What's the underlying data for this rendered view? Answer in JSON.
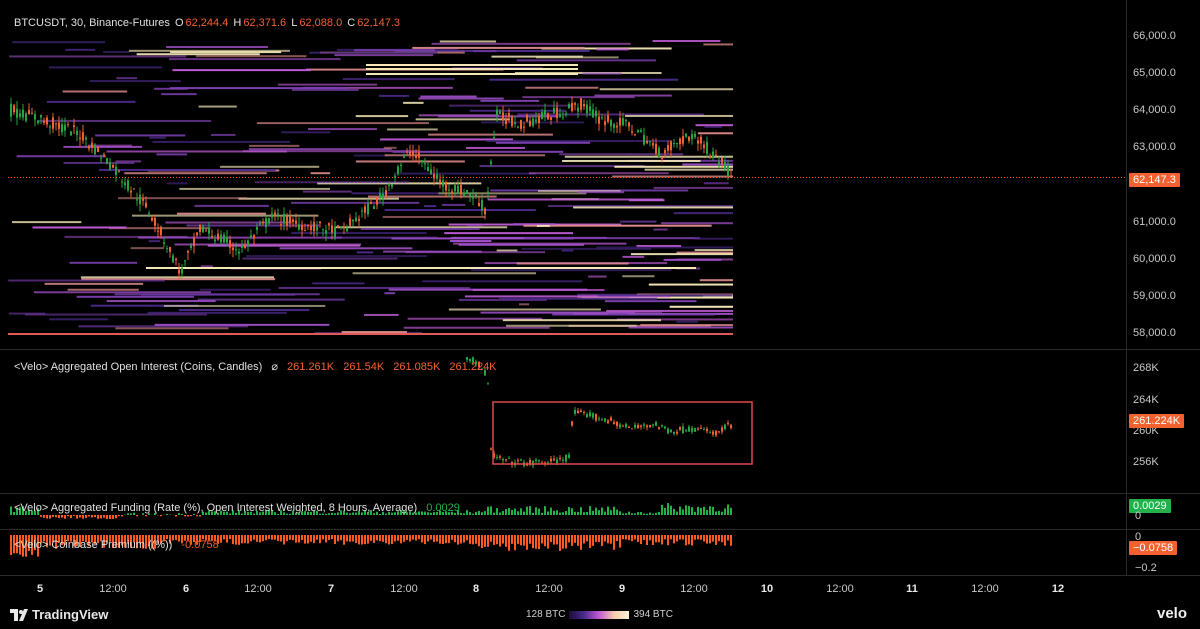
{
  "colors": {
    "up": "#26a641",
    "down": "#f2612f",
    "price_line": "#ff5a1f",
    "box": "#e04848",
    "funding_pos": "#21b24a",
    "premium": "#ff5a1f",
    "heat_low": "#4b2a8a",
    "heat_mid": "#c05bd6",
    "heat_high": "#f3e7b6"
  },
  "main": {
    "symbol": "BTCUSDT, 30, Binance-Futures",
    "o_label": "O",
    "o_value": "62,244.4",
    "h_label": "H",
    "h_value": "62,371.6",
    "l_label": "L",
    "l_value": "62,088.0",
    "c_label": "C",
    "c_value": "62,147.3",
    "current_price": "62,147.3",
    "y_ticks": [
      "66,000.0",
      "65,000.0",
      "64,000.0",
      "63,000.0",
      "61,000.0",
      "60,000.0",
      "59,000.0",
      "58,000.0"
    ]
  },
  "oi": {
    "label": "<Velo> Aggregated Open Interest (Coins, Candles)",
    "symbol": "⌀",
    "values": [
      "261.261K",
      "261.54K",
      "261.085K",
      "261.224K"
    ],
    "current": "261.224K",
    "y_ticks": [
      "268K",
      "264K",
      "260K",
      "256K"
    ]
  },
  "funding": {
    "label": "<Velo> Aggregated Funding (Rate (%), Open Interest Weighted, 8 Hours, Average)",
    "value": "0.0029",
    "current": "0.0029",
    "zero_tick": "0"
  },
  "premium": {
    "label": "<Velo> Coinbase Premium ((%))",
    "value": "-0.0758",
    "current": "−0.0758",
    "zero_tick": "0",
    "low_tick": "−0.2"
  },
  "x_axis": [
    "5",
    "12:00",
    "6",
    "12:00",
    "7",
    "12:00",
    "8",
    "12:00",
    "9",
    "12:00",
    "10",
    "12:00",
    "11",
    "12:00",
    "12"
  ],
  "footer": {
    "brand": "TradingView",
    "legend_min": "128 BTC",
    "legend_max": "394 BTC",
    "velo": "velo"
  }
}
